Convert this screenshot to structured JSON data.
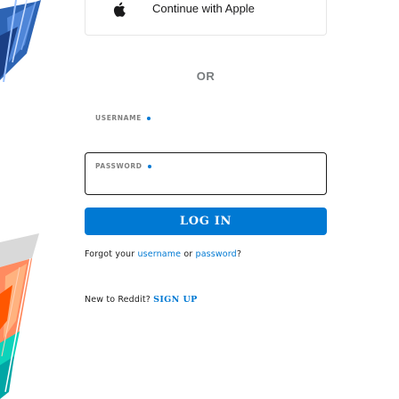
{
  "social": {
    "icon": "apple-icon",
    "label": "Continue with Apple"
  },
  "divider": {
    "label": "OR"
  },
  "form": {
    "username_label": "USERNAME",
    "password_label": "PASSWORD",
    "username_value": "",
    "password_value": "",
    "login_label": "LOG IN"
  },
  "forgot": {
    "prefix": "Forgot your ",
    "username_link": "username",
    "middle": " or ",
    "password_link": "password",
    "suffix": "?"
  },
  "signup": {
    "prefix": "New to Reddit? ",
    "link": "SIGN UP"
  },
  "colors": {
    "accent": "#0079d3",
    "text": "#1c1c1c",
    "muted": "#787c7e"
  }
}
